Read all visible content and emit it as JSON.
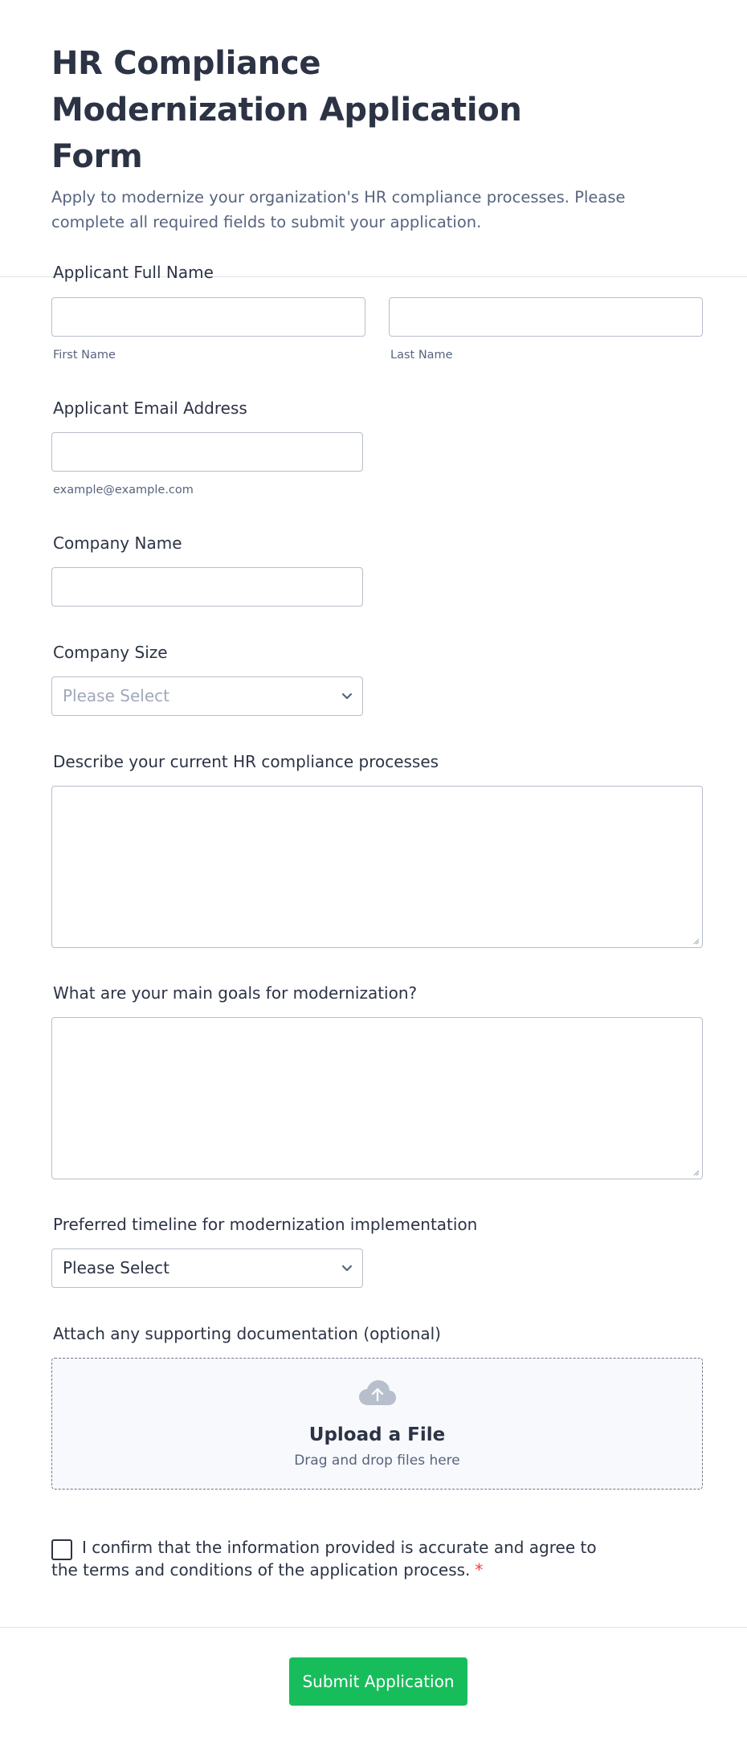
{
  "header": {
    "title": "HR Compliance Modernization Application Form",
    "subtitle": "Apply to modernize your organization's HR compliance processes. Please complete all required fields to submit your application."
  },
  "fields": {
    "full_name": {
      "label": "Applicant Full Name",
      "first_sublabel": "First Name",
      "last_sublabel": "Last Name",
      "first_value": "",
      "last_value": ""
    },
    "email": {
      "label": "Applicant Email Address",
      "sublabel": "example@example.com",
      "value": ""
    },
    "company_name": {
      "label": "Company Name",
      "value": ""
    },
    "company_size": {
      "label": "Company Size",
      "selected": "Please Select"
    },
    "current_processes": {
      "label": "Describe your current HR compliance processes",
      "value": ""
    },
    "main_goals": {
      "label": "What are your main goals for modernization?",
      "value": ""
    },
    "timeline": {
      "label": "Preferred timeline for modernization implementation",
      "selected": "Please Select"
    },
    "attachment": {
      "label": "Attach any supporting documentation (optional)",
      "upload_title": "Upload a File",
      "upload_subtitle": "Drag and drop files here",
      "icon": "cloud-upload-icon"
    },
    "consent": {
      "text": "I confirm that the information provided is accurate and agree to the terms and conditions of the application process.",
      "required_mark": "*",
      "checked": false
    }
  },
  "submit": {
    "label": "Submit Application"
  },
  "colors": {
    "text_primary": "#2c3345",
    "text_secondary": "#57647e",
    "placeholder": "#a0a8b8",
    "border": "#b8bdc9",
    "submit_bg": "#18bd5b",
    "required": "#f23a3c",
    "upload_bg": "#f8f9fc"
  }
}
